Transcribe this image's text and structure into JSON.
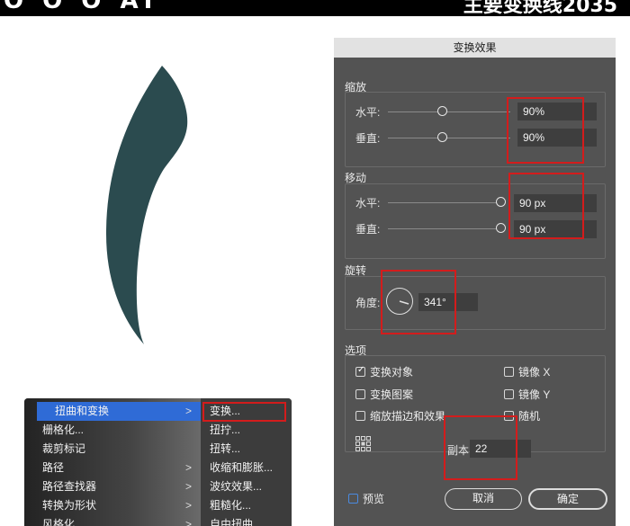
{
  "banner": {
    "left": "O O O  AI",
    "right": "主要变换线2035"
  },
  "menu": {
    "items": [
      {
        "label": "扭曲和变换",
        "arrow": ">",
        "active": true
      },
      {
        "label": "栅格化...",
        "arrow": ""
      },
      {
        "label": "裁剪标记",
        "arrow": ""
      },
      {
        "label": "路径",
        "arrow": ">"
      },
      {
        "label": "路径查找器",
        "arrow": ">"
      },
      {
        "label": "转换为形状",
        "arrow": ">"
      },
      {
        "label": "风格化",
        "arrow": ">"
      }
    ],
    "submenu": [
      {
        "label": "变换..."
      },
      {
        "label": "扭拧..."
      },
      {
        "label": "扭转..."
      },
      {
        "label": "收缩和膨胀..."
      },
      {
        "label": "波纹效果..."
      },
      {
        "label": "粗糙化..."
      },
      {
        "label": "自由扭曲..."
      }
    ]
  },
  "dialog": {
    "title": "变换效果",
    "scale": {
      "title": "缩放",
      "h_label": "水平:",
      "h_value": "90%",
      "v_label": "垂直:",
      "v_value": "90%"
    },
    "move": {
      "title": "移动",
      "h_label": "水平:",
      "h_value": "90 px",
      "v_label": "垂直:",
      "v_value": "90 px"
    },
    "rotate": {
      "title": "旋转",
      "angle_label": "角度:",
      "angle_value": "341°"
    },
    "options": {
      "title": "选项",
      "transform_objects": "变换对象",
      "transform_patterns": "变换图案",
      "scale_strokes": "缩放描边和效果",
      "reflect_x": "镜像 X",
      "reflect_y": "镜像 Y",
      "random": "随机"
    },
    "copies_label": "副本",
    "copies_value": "22",
    "preview_label": "预览",
    "cancel_label": "取消",
    "ok_label": "确定"
  },
  "colors": {
    "shape": "#2b4b4f",
    "highlight": "#d31c1c",
    "menu_active": "#2f6bd6"
  }
}
